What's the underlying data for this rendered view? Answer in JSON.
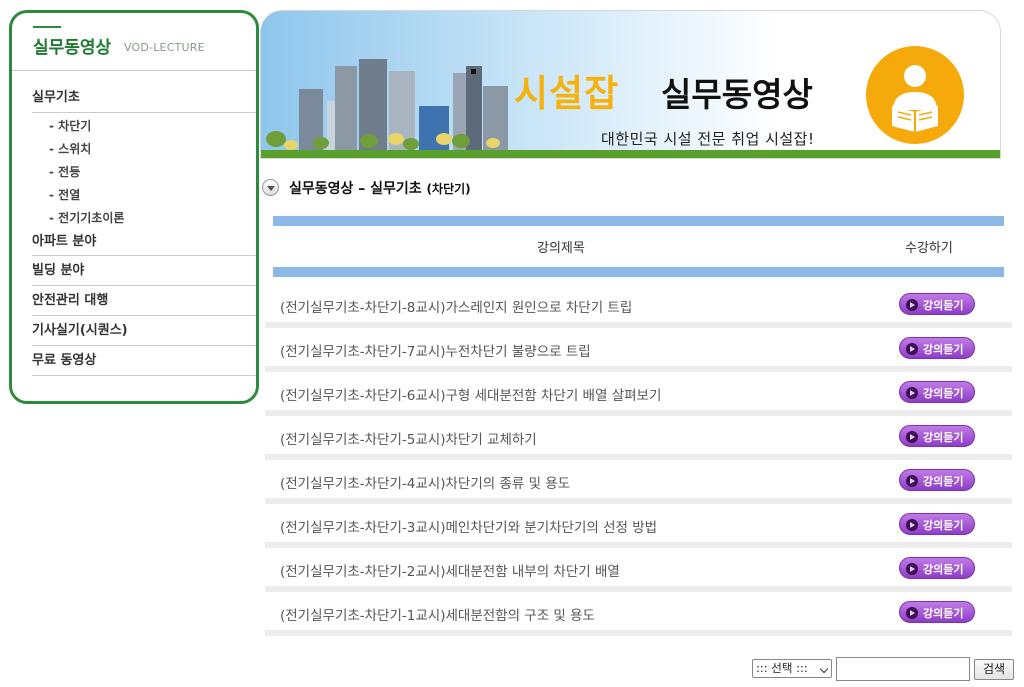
{
  "sidebar": {
    "title": "실무동영상",
    "subtitle": "VOD-LECTURE",
    "categories": [
      {
        "label": "실무기초"
      },
      {
        "label": "아파트 분야"
      },
      {
        "label": "빌딩 분야"
      },
      {
        "label": "안전관리 대행"
      },
      {
        "label": "기사실기(시퀀스)"
      },
      {
        "label": "무료 동영상"
      }
    ],
    "subitems": [
      "차단기",
      "스위치",
      "전등",
      "전열",
      "전기기초이론"
    ]
  },
  "banner": {
    "title_brand": "시설잡",
    "title_rest": "실무동영상",
    "subtitle": "대한민국 시설 전문 취업 시설잡!"
  },
  "section": {
    "title": "실무동영상 – 실무기초",
    "category": "(차단기)"
  },
  "table": {
    "headers": {
      "title": "강의제목",
      "action": "수강하기"
    },
    "button_label": "강의듣기",
    "rows": [
      {
        "title": "(전기실무기초-차단기-8교시)가스레인지 원인으로 차단기 트립"
      },
      {
        "title": "(전기실무기초-차단기-7교시)누전차단기 불량으로 트립"
      },
      {
        "title": "(전기실무기초-차단기-6교시)구형 세대분전함 차단기 배열 살펴보기"
      },
      {
        "title": "(전기실무기초-차단기-5교시)차단기 교체하기"
      },
      {
        "title": "(전기실무기초-차단기-4교시)차단기의 종류 및 용도"
      },
      {
        "title": "(전기실무기초-차단기-3교시)메인차단기와 분기차단기의 선정 방법"
      },
      {
        "title": "(전기실무기초-차단기-2교시)세대분전함 내부의 차단기 배열"
      },
      {
        "title": "(전기실무기초-차단기-1교시)세대분전함의 구조 및 용도"
      }
    ]
  },
  "search": {
    "select_value": "::: 선택 :::",
    "input_value": "",
    "button_label": "검색"
  },
  "colors": {
    "sidebar_border": "#2e8b3e",
    "brand_yellow": "#f5b20d",
    "table_bar": "#8cb8e8",
    "button_purple": "#a458d6"
  }
}
